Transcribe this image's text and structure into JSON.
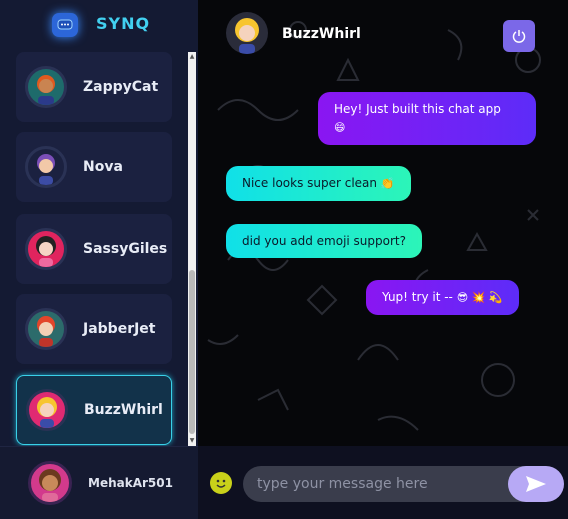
{
  "brand": {
    "name": "SYNQ",
    "logo_icon": "chat-bubble-icon"
  },
  "contacts": [
    {
      "name": "ZappyCat",
      "avatar_bg": "#1e6b6b",
      "hair": "#e05a1f",
      "skin": "#c98451"
    },
    {
      "name": "Nova",
      "avatar_bg": "#1b2140",
      "hair": "#7b4fb8",
      "skin": "#f2c9a8"
    },
    {
      "name": "SassyGiles",
      "avatar_bg": "#e0245e",
      "hair": "#222222",
      "skin": "#f6d5c4"
    },
    {
      "name": "JabberJet",
      "avatar_bg": "#2c6b6b",
      "hair": "#e2452a",
      "skin": "#f2d0b5"
    },
    {
      "name": "BuzzWhirl",
      "avatar_bg": "#e02a72",
      "hair": "#f7c52f",
      "skin": "#f5d3bd"
    }
  ],
  "active_contact": "BuzzWhirl",
  "current_user": {
    "name": "MehakAr501",
    "avatar_bg": "#d23a8c",
    "hair": "#6b3a1e",
    "skin": "#c88a5a"
  },
  "chat": {
    "title": "BuzzWhirl",
    "power_icon": "power-icon",
    "messages": [
      {
        "direction": "out",
        "text": "Hey! Just built this chat app",
        "emoji": "😄"
      },
      {
        "direction": "in",
        "text": "Nice looks super clean",
        "emoji": "👏"
      },
      {
        "direction": "in",
        "text": "did you add emoji support?"
      },
      {
        "direction": "out",
        "text": "Yup! try it --",
        "emoji": "😎 💥 💫"
      }
    ]
  },
  "composer": {
    "placeholder": "type your message here",
    "emoji_icon": "smiley-icon",
    "send_icon": "send-icon"
  },
  "colors": {
    "accent": "#42d0f0",
    "outgoing": "#7a20f5",
    "incoming": "#18ead8",
    "send": "#b7a9f5"
  }
}
